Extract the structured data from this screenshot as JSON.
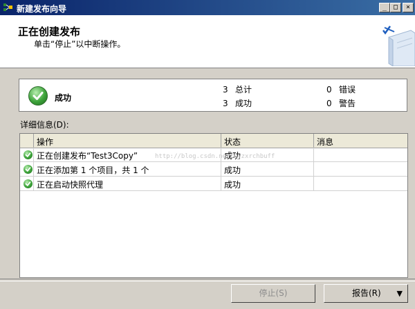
{
  "window": {
    "title": "新建发布向导",
    "controls": {
      "minimize": "_",
      "maximize": "□",
      "close": "×"
    }
  },
  "header": {
    "title": "正在创建发布",
    "subtitle": "单击“停止”以中断操作。"
  },
  "summary": {
    "status": "成功",
    "total_count": "3",
    "total_label": "总计",
    "success_count": "3",
    "success_label": "成功",
    "error_count": "0",
    "error_label": "错误",
    "warning_count": "0",
    "warning_label": "警告"
  },
  "details_label": "详细信息(D):",
  "grid": {
    "columns": [
      "操作",
      "状态",
      "消息"
    ],
    "rows": [
      {
        "action": "正在创建发布“Test3Copy”",
        "status": "成功",
        "message": ""
      },
      {
        "action": "正在添加第 1 个项目，共 1 个",
        "status": "成功",
        "message": ""
      },
      {
        "action": "正在启动快照代理",
        "status": "成功",
        "message": ""
      }
    ]
  },
  "watermark": "http://blog.csdn.net/wyzxrchbuff",
  "buttons": {
    "stop": "停止(S)",
    "report": "报告(R)",
    "report_arrow": "▼"
  },
  "colors": {
    "titlebar_start": "#0a246a",
    "titlebar_end": "#3a6ea5",
    "success_green": "#3da33a"
  }
}
